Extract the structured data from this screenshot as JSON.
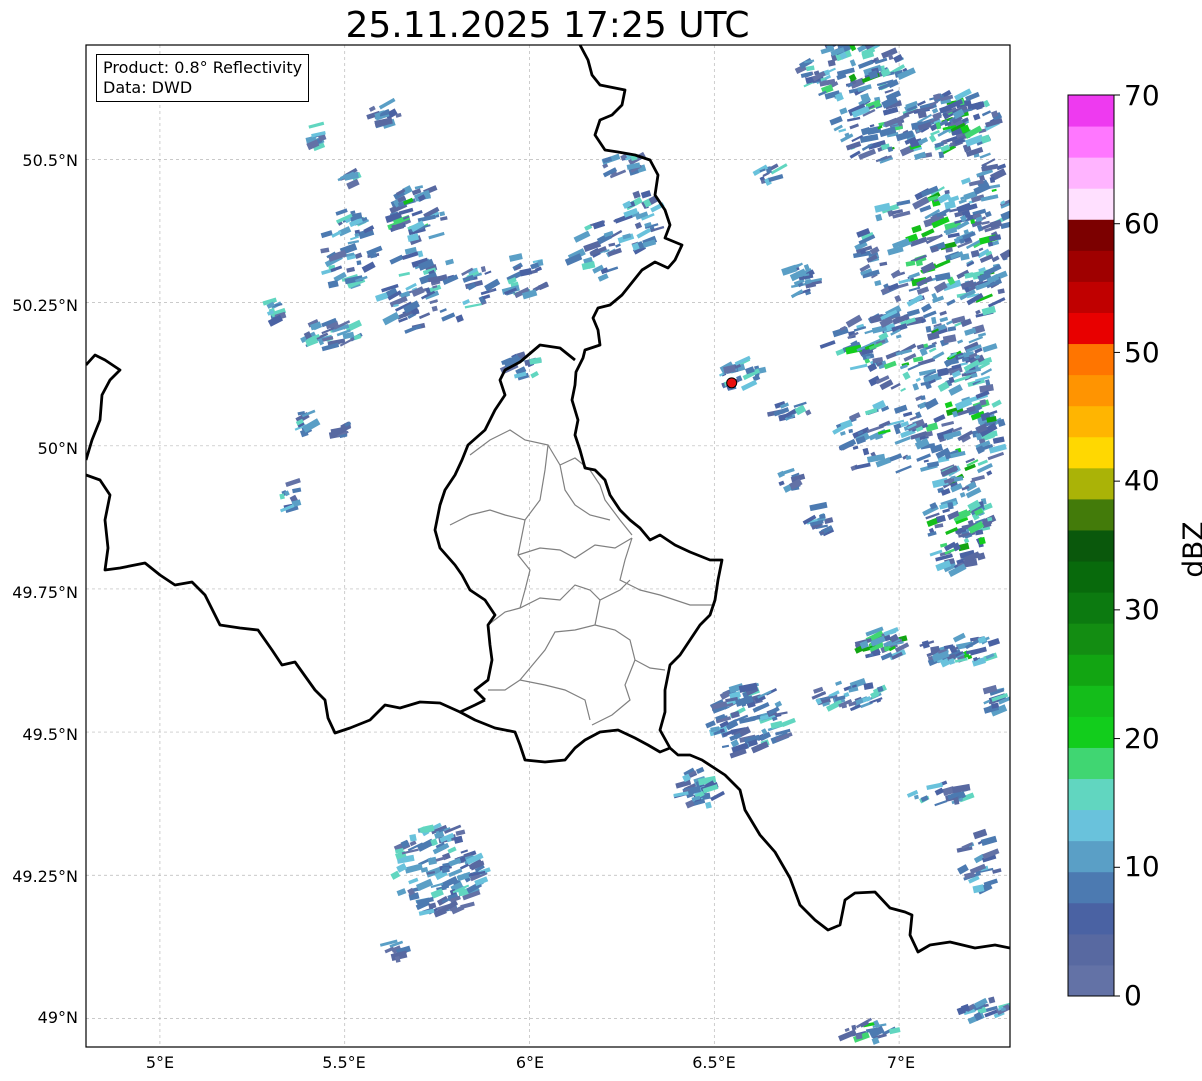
{
  "title": "25.11.2025 17:25 UTC",
  "info": {
    "product": "Product: 0.8° Reflectivity",
    "data": "Data: DWD"
  },
  "axes": {
    "lat_labels": [
      "50.5°N",
      "50.25°N",
      "50°N",
      "49.75°N",
      "49.5°N",
      "49.25°N",
      "49°N"
    ],
    "lon_labels": [
      "5°E",
      "5.5°E",
      "6°E",
      "6.5°E",
      "7°E"
    ],
    "lon_range": [
      4.8,
      7.3
    ],
    "lat_range": [
      48.95,
      50.7
    ]
  },
  "colorbar": {
    "label": "dBZ",
    "ticks": [
      "0",
      "10",
      "20",
      "30",
      "40",
      "50",
      "60",
      "70"
    ],
    "range": [
      0,
      70
    ],
    "colors": [
      "#6372a6",
      "#5869a1",
      "#4a62a3",
      "#4c7ab1",
      "#5a9fc6",
      "#69c2dc",
      "#61d6c0",
      "#40d672",
      "#12cd1c",
      "#14bd1a",
      "#12a512",
      "#138d12",
      "#0c7a10",
      "#086a0c",
      "#0a580c",
      "#437b0a",
      "#aab307",
      "#ffd801",
      "#ffb501",
      "#ff9401",
      "#ff7500",
      "#e80000",
      "#c00000",
      "#9f0000",
      "#7c0000",
      "#ffe0ff",
      "#ffb4ff",
      "#ff77ff",
      "#ee3af0"
    ]
  },
  "radar_site": {
    "lon": 6.547,
    "lat": 50.11,
    "color": "#e81010"
  }
}
